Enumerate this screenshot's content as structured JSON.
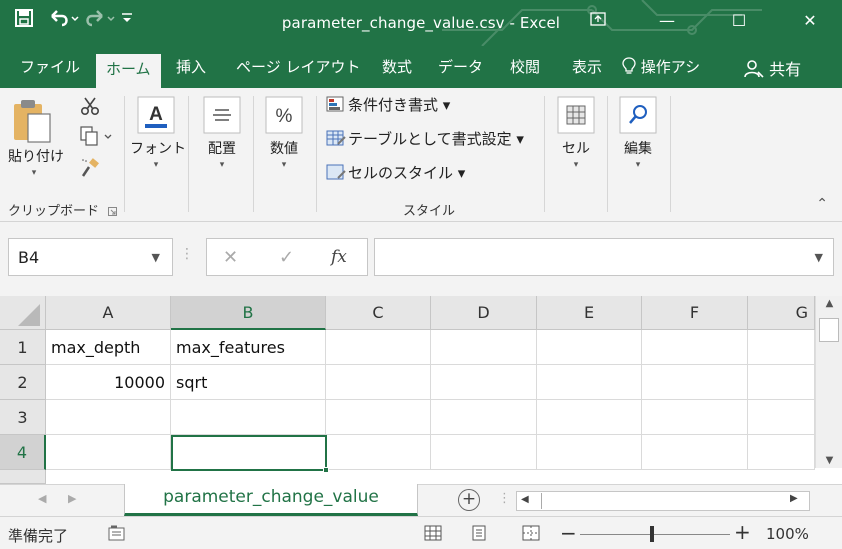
{
  "window": {
    "title": "parameter_change_value.csv - Excel",
    "minimize": "—",
    "maximize": "☐",
    "close": "✕"
  },
  "quick_access": {
    "save_icon": "save-icon",
    "undo_icon": "undo-icon",
    "redo_icon": "redo-icon"
  },
  "menu": {
    "tabs": [
      "ファイル",
      "ホーム",
      "挿入",
      "ページ レイアウト",
      "数式",
      "データ",
      "校閲",
      "表示"
    ],
    "active": "ホーム",
    "tell_me": "操作アシ",
    "share": "共有"
  },
  "ribbon": {
    "paste": "貼り付け",
    "clipboard_group": "クリップボード",
    "font": "フォント",
    "alignment": "配置",
    "number": "数値",
    "conditional_formatting": "条件付き書式",
    "format_as_table": "テーブルとして書式設定",
    "cell_styles": "セルのスタイル",
    "styles_group": "スタイル",
    "cells": "セル",
    "editing": "編集"
  },
  "formula_bar": {
    "name_box": "B4",
    "fx": "fx",
    "value": ""
  },
  "grid": {
    "columns": [
      "A",
      "B",
      "C",
      "D",
      "E",
      "F",
      "G"
    ],
    "selected_column": "B",
    "rows": [
      "1",
      "2",
      "3",
      "4"
    ],
    "selected_row": "4",
    "cells": {
      "A1": "max_depth",
      "B1": "max_features",
      "A2": "10000",
      "B2": "sqrt"
    }
  },
  "sheet_tabs": {
    "active": "parameter_change_value",
    "add": "+"
  },
  "status_bar": {
    "ready": "準備完了",
    "zoom": "100%",
    "zoom_minus": "−",
    "zoom_plus": "+"
  },
  "colors": {
    "excel_green": "#217346",
    "ribbon_bg": "#f3f3f3"
  }
}
